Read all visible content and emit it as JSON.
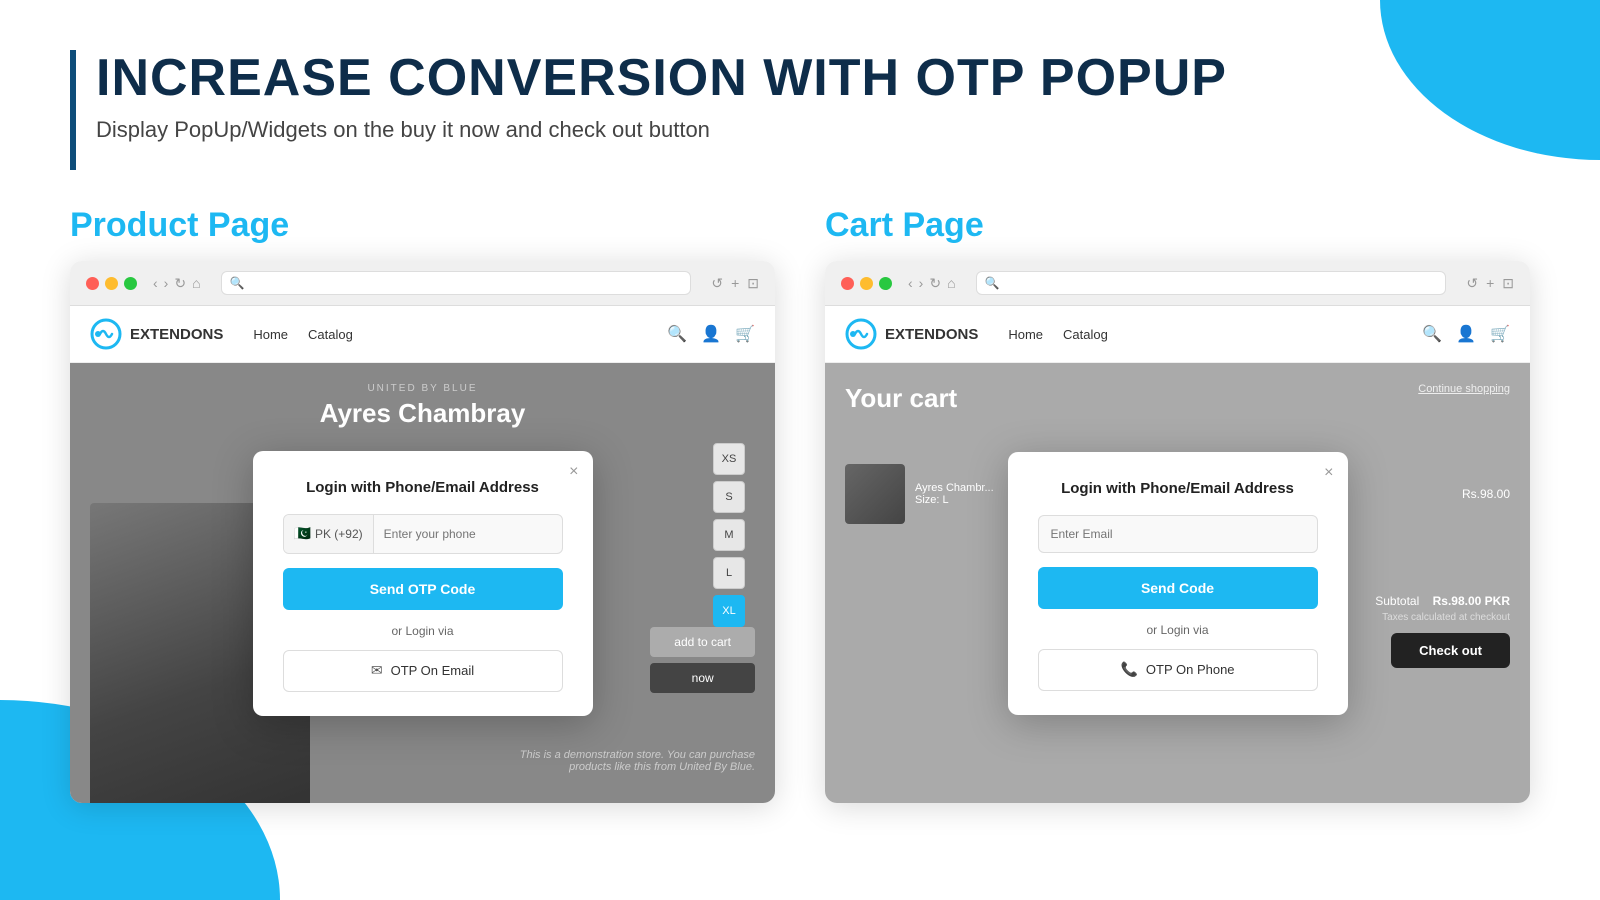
{
  "page": {
    "title": "INCREASE CONVERSION WITH OTP POPUP",
    "subtitle": "Display PopUp/Widgets on the buy it now and check out button"
  },
  "product_section": {
    "label": "Product Page",
    "brand": "UNITED BY BLUE",
    "product_name": "Ayres Chambray",
    "sizes": [
      "XS",
      "S",
      "M",
      "L",
      "XL"
    ]
  },
  "cart_section": {
    "label": "Cart Page",
    "cart_heading": "Your cart",
    "continue_shopping": "Continue shopping",
    "item_name": "Ayres Chambr...",
    "item_size": "Size: L",
    "item_price": "Rs.98.00",
    "subtotal_label": "Subtotal",
    "subtotal_value": "Rs.98.00 PKR",
    "tax_note": "Taxes calculated at checkout",
    "checkout_label": "Check out"
  },
  "product_popup": {
    "title": "Login with Phone/Email Address",
    "close_icon": "×",
    "flag": "🇵🇰",
    "flag_code": "PK (+92)",
    "phone_placeholder": "Enter your phone",
    "send_btn_label": "Send OTP Code",
    "or_text": "or Login via",
    "alt_btn_label": "OTP On Email",
    "alt_icon": "✉"
  },
  "cart_popup": {
    "title": "Login with Phone/Email Address",
    "close_icon": "×",
    "email_placeholder": "Enter Email",
    "send_btn_label": "Send Code",
    "or_text": "or Login via",
    "alt_btn_label": "OTP On Phone",
    "alt_icon": "📞"
  },
  "browser": {
    "nav_back": "‹",
    "nav_forward": "›",
    "nav_home": "⌂",
    "refresh": "↺",
    "new_tab": "+",
    "nav_home2": "Home",
    "nav_catalog": "Catalog"
  },
  "store": {
    "name": "EXTENDONS"
  },
  "demo_text": "This is a demonstration store. You can purchase products like this from United By Blue.",
  "colors": {
    "accent": "#1db8f2",
    "dark_title": "#0e2d4a",
    "send_btn": "#1db8f2",
    "checkout_btn": "#222"
  }
}
